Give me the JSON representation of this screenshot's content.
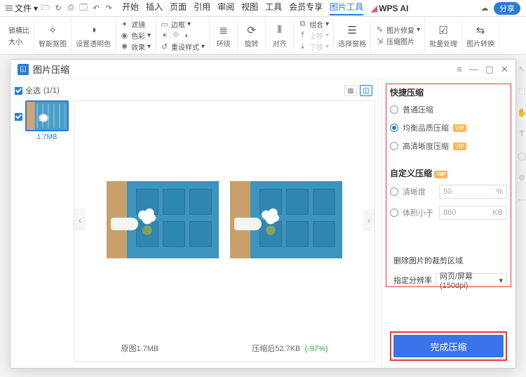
{
  "topbar": {
    "file": "文件",
    "tabs": [
      "开始",
      "插入",
      "页面",
      "引用",
      "审阅",
      "视图",
      "工具",
      "会员专享",
      "图片工具"
    ],
    "active_tab": "图片工具",
    "ai": "WPS AI",
    "share": "分享"
  },
  "ribbon": {
    "first_top": "锁横比",
    "first_bottom": "大小",
    "smart_crop": "智能抠图",
    "transparency": "设置透明色",
    "filter": "滤镜",
    "color": "色彩",
    "effect": "效果",
    "border": "边框",
    "reset": "重设样式",
    "wrap": "环绕",
    "rotate": "旋转",
    "align": "对齐",
    "group": "组合",
    "top": "上移",
    "bottom": "下移",
    "pane": "选择窗格",
    "repair": "图片修复",
    "compress": "压缩图片",
    "batch": "批量处理",
    "convert": "图片转换"
  },
  "dialog": {
    "title": "图片压缩",
    "select_all": "全选",
    "count": "(1/1)",
    "thumb_size": "1.7MB",
    "preview": {
      "original_label": "原图",
      "original_size": "1.7MB",
      "after_label": "压缩后",
      "after_size": "52.7KB",
      "reduction": "(-97%)"
    },
    "quick_title": "快捷压缩",
    "opt_normal": "普通压缩",
    "opt_balance": "均衡品质压缩",
    "opt_clear": "高清晰度压缩",
    "custom_title": "自定义压缩",
    "clarity_label": "清晰度",
    "clarity_value": "50",
    "clarity_unit": "%",
    "size_label": "体积小于",
    "size_value": "860",
    "size_unit": "KB",
    "chk_crop": "删除图片的裁剪区域",
    "chk_dpi": "指定分辨率",
    "dpi_value": "网页/屏幕(150dpi)",
    "confirm": "完成压缩"
  }
}
